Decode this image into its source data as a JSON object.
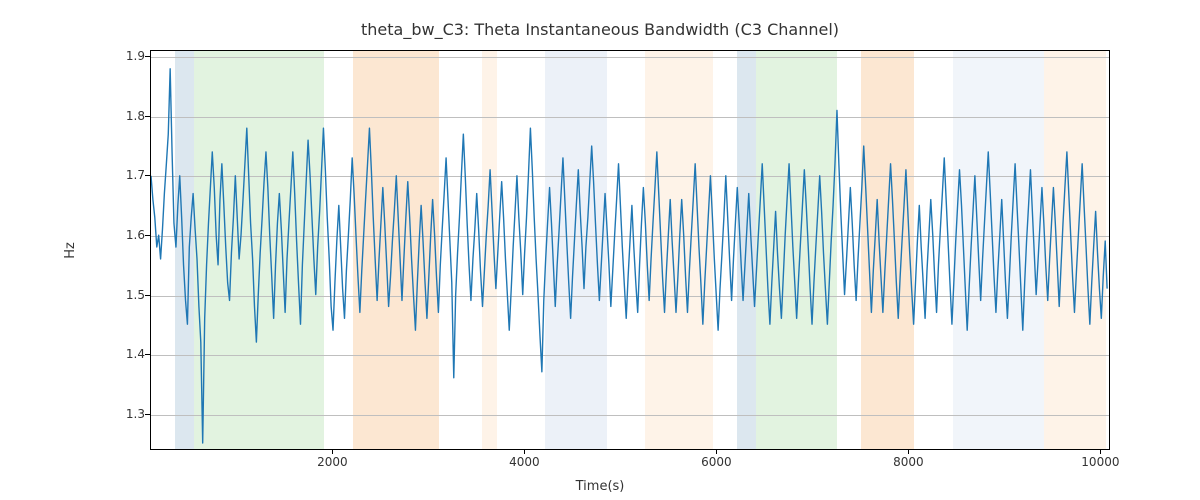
{
  "chart_data": {
    "type": "line",
    "title": "theta_bw_C3: Theta Instantaneous Bandwidth (C3 Channel)",
    "xlabel": "Time(s)",
    "ylabel": "Hz",
    "xlim": [
      100,
      10100
    ],
    "ylim": [
      1.24,
      1.91
    ],
    "xticks": [
      2000,
      4000,
      6000,
      8000,
      10000
    ],
    "yticks": [
      1.3,
      1.4,
      1.5,
      1.6,
      1.7,
      1.8,
      1.9
    ],
    "background_regions": [
      {
        "x0": 350,
        "x1": 550,
        "color": "#a7c4d8"
      },
      {
        "x0": 550,
        "x1": 1900,
        "color": "#b7e0b1"
      },
      {
        "x0": 2200,
        "x1": 3100,
        "color": "#f7c48f"
      },
      {
        "x0": 3550,
        "x1": 3700,
        "color": "#fde2c6"
      },
      {
        "x0": 4200,
        "x1": 4850,
        "color": "#cfdced"
      },
      {
        "x0": 5250,
        "x1": 5950,
        "color": "#fde2c6"
      },
      {
        "x0": 6200,
        "x1": 6400,
        "color": "#a7c4d8"
      },
      {
        "x0": 6400,
        "x1": 7250,
        "color": "#b7e0b1"
      },
      {
        "x0": 7500,
        "x1": 8050,
        "color": "#f7c48f"
      },
      {
        "x0": 8450,
        "x1": 9400,
        "color": "#dde6f2"
      },
      {
        "x0": 9400,
        "x1": 10050,
        "color": "#fde2c6"
      }
    ],
    "series": [
      {
        "name": "theta_bw_C3",
        "x_start": 100,
        "x_step": 20,
        "values": [
          1.7,
          1.66,
          1.63,
          1.58,
          1.6,
          1.56,
          1.61,
          1.67,
          1.72,
          1.77,
          1.88,
          1.74,
          1.62,
          1.58,
          1.65,
          1.7,
          1.63,
          1.55,
          1.49,
          1.45,
          1.58,
          1.63,
          1.67,
          1.61,
          1.56,
          1.48,
          1.42,
          1.25,
          1.46,
          1.55,
          1.62,
          1.68,
          1.74,
          1.68,
          1.6,
          1.55,
          1.66,
          1.72,
          1.65,
          1.58,
          1.52,
          1.49,
          1.57,
          1.63,
          1.7,
          1.63,
          1.56,
          1.6,
          1.66,
          1.72,
          1.78,
          1.7,
          1.62,
          1.56,
          1.48,
          1.42,
          1.5,
          1.57,
          1.63,
          1.69,
          1.74,
          1.68,
          1.6,
          1.53,
          1.46,
          1.55,
          1.62,
          1.67,
          1.61,
          1.54,
          1.47,
          1.56,
          1.62,
          1.68,
          1.74,
          1.67,
          1.59,
          1.52,
          1.45,
          1.55,
          1.62,
          1.69,
          1.76,
          1.7,
          1.63,
          1.56,
          1.5,
          1.58,
          1.64,
          1.71,
          1.78,
          1.71,
          1.63,
          1.56,
          1.48,
          1.44,
          1.52,
          1.59,
          1.65,
          1.58,
          1.51,
          1.46,
          1.54,
          1.6,
          1.66,
          1.73,
          1.67,
          1.6,
          1.53,
          1.47,
          1.54,
          1.6,
          1.66,
          1.72,
          1.78,
          1.71,
          1.63,
          1.56,
          1.49,
          1.56,
          1.62,
          1.68,
          1.62,
          1.55,
          1.48,
          1.53,
          1.59,
          1.64,
          1.7,
          1.63,
          1.56,
          1.49,
          1.56,
          1.63,
          1.69,
          1.63,
          1.56,
          1.5,
          1.44,
          1.52,
          1.59,
          1.65,
          1.59,
          1.52,
          1.46,
          1.53,
          1.6,
          1.66,
          1.6,
          1.53,
          1.47,
          1.55,
          1.61,
          1.67,
          1.73,
          1.66,
          1.59,
          1.52,
          1.36,
          1.5,
          1.57,
          1.63,
          1.7,
          1.77,
          1.7,
          1.62,
          1.55,
          1.49,
          1.56,
          1.61,
          1.67,
          1.61,
          1.54,
          1.48,
          1.54,
          1.6,
          1.65,
          1.71,
          1.64,
          1.57,
          1.51,
          1.57,
          1.63,
          1.69,
          1.63,
          1.56,
          1.5,
          1.44,
          1.51,
          1.58,
          1.64,
          1.7,
          1.63,
          1.57,
          1.5,
          1.57,
          1.63,
          1.7,
          1.78,
          1.71,
          1.63,
          1.56,
          1.5,
          1.43,
          1.37,
          1.49,
          1.56,
          1.62,
          1.68,
          1.62,
          1.55,
          1.48,
          1.55,
          1.61,
          1.67,
          1.73,
          1.66,
          1.59,
          1.52,
          1.46,
          1.53,
          1.59,
          1.65,
          1.71,
          1.64,
          1.58,
          1.51,
          1.58,
          1.63,
          1.69,
          1.75,
          1.69,
          1.62,
          1.55,
          1.49,
          1.55,
          1.61,
          1.67,
          1.61,
          1.55,
          1.48,
          1.54,
          1.6,
          1.66,
          1.72,
          1.65,
          1.58,
          1.52,
          1.46,
          1.53,
          1.59,
          1.65,
          1.58,
          1.52,
          1.47,
          1.55,
          1.62,
          1.68,
          1.62,
          1.55,
          1.49,
          1.56,
          1.62,
          1.68,
          1.74,
          1.67,
          1.6,
          1.53,
          1.47,
          1.54,
          1.6,
          1.66,
          1.59,
          1.53,
          1.47,
          1.53,
          1.6,
          1.66,
          1.6,
          1.53,
          1.47,
          1.54,
          1.6,
          1.66,
          1.72,
          1.65,
          1.58,
          1.52,
          1.45,
          1.52,
          1.58,
          1.64,
          1.7,
          1.63,
          1.56,
          1.5,
          1.44,
          1.51,
          1.57,
          1.63,
          1.7,
          1.63,
          1.56,
          1.49,
          1.56,
          1.62,
          1.68,
          1.62,
          1.55,
          1.49,
          1.55,
          1.61,
          1.67,
          1.6,
          1.54,
          1.48,
          1.54,
          1.6,
          1.66,
          1.72,
          1.65,
          1.58,
          1.51,
          1.45,
          1.52,
          1.58,
          1.64,
          1.57,
          1.51,
          1.46,
          1.53,
          1.6,
          1.66,
          1.72,
          1.65,
          1.58,
          1.52,
          1.46,
          1.53,
          1.59,
          1.65,
          1.71,
          1.65,
          1.58,
          1.51,
          1.45,
          1.52,
          1.58,
          1.64,
          1.7,
          1.64,
          1.57,
          1.51,
          1.45,
          1.52,
          1.59,
          1.65,
          1.72,
          1.81,
          1.72,
          1.64,
          1.57,
          1.5,
          1.56,
          1.62,
          1.68,
          1.62,
          1.55,
          1.49,
          1.56,
          1.62,
          1.68,
          1.75,
          1.68,
          1.61,
          1.54,
          1.47,
          1.54,
          1.6,
          1.66,
          1.59,
          1.53,
          1.47,
          1.54,
          1.6,
          1.66,
          1.72,
          1.66,
          1.59,
          1.52,
          1.46,
          1.53,
          1.59,
          1.65,
          1.71,
          1.64,
          1.57,
          1.51,
          1.45,
          1.52,
          1.59,
          1.65,
          1.58,
          1.52,
          1.46,
          1.54,
          1.6,
          1.66,
          1.6,
          1.53,
          1.47,
          1.55,
          1.61,
          1.67,
          1.73,
          1.66,
          1.59,
          1.52,
          1.45,
          1.52,
          1.59,
          1.65,
          1.71,
          1.65,
          1.58,
          1.51,
          1.44,
          1.51,
          1.58,
          1.64,
          1.7,
          1.63,
          1.56,
          1.49,
          1.56,
          1.62,
          1.68,
          1.74,
          1.67,
          1.6,
          1.53,
          1.47,
          1.54,
          1.6,
          1.66,
          1.59,
          1.52,
          1.46,
          1.53,
          1.6,
          1.66,
          1.72,
          1.65,
          1.58,
          1.51,
          1.44,
          1.52,
          1.59,
          1.65,
          1.71,
          1.64,
          1.57,
          1.5,
          1.56,
          1.62,
          1.68,
          1.62,
          1.55,
          1.49,
          1.56,
          1.62,
          1.68,
          1.62,
          1.55,
          1.48,
          1.55,
          1.62,
          1.68,
          1.74,
          1.67,
          1.6,
          1.53,
          1.47,
          1.54,
          1.6,
          1.66,
          1.72,
          1.65,
          1.58,
          1.51,
          1.45,
          1.52,
          1.58,
          1.64,
          1.57,
          1.51,
          1.46,
          1.53,
          1.59,
          1.51
        ]
      }
    ]
  }
}
